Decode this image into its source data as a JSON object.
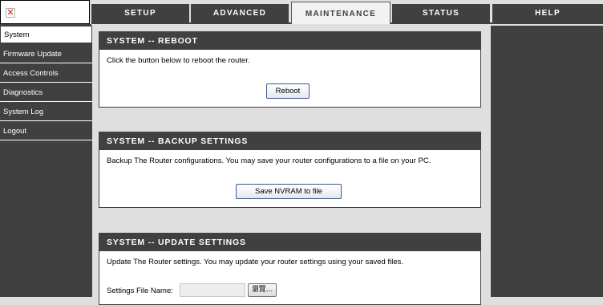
{
  "logo": {
    "icon": "broken-image-x-icon",
    "glyph": "✕"
  },
  "tabs": [
    {
      "label": "SETUP",
      "active": false
    },
    {
      "label": "ADVANCED",
      "active": false
    },
    {
      "label": "MAINTENANCE",
      "active": true
    },
    {
      "label": "STATUS",
      "active": false
    },
    {
      "label": "HELP",
      "active": false
    }
  ],
  "sidebar": {
    "items": [
      {
        "label": "System",
        "active": true
      },
      {
        "label": "Firmware Update",
        "active": false
      },
      {
        "label": "Access Controls",
        "active": false
      },
      {
        "label": "Diagnostics",
        "active": false
      },
      {
        "label": "System Log",
        "active": false
      },
      {
        "label": "Logout",
        "active": false
      }
    ]
  },
  "reboot": {
    "title": "SYSTEM -- REBOOT",
    "text": "Click the button below to reboot the router.",
    "button": "Reboot"
  },
  "backup": {
    "title": "SYSTEM -- BACKUP SETTINGS",
    "text": "Backup The Router configurations. You may save your router configurations to a file on your PC.",
    "button": "Save NVRAM to file"
  },
  "update": {
    "title": "SYSTEM -- UPDATE SETTINGS",
    "text": "Update The Router settings. You may update your router settings using your saved files.",
    "file_label": "Settings File Name:",
    "file_value": "",
    "browse_button": "瀏覽..."
  },
  "colors": {
    "dark": "#404040",
    "page_bg": "#dfdfdf",
    "button_border": "#3c5a88"
  }
}
